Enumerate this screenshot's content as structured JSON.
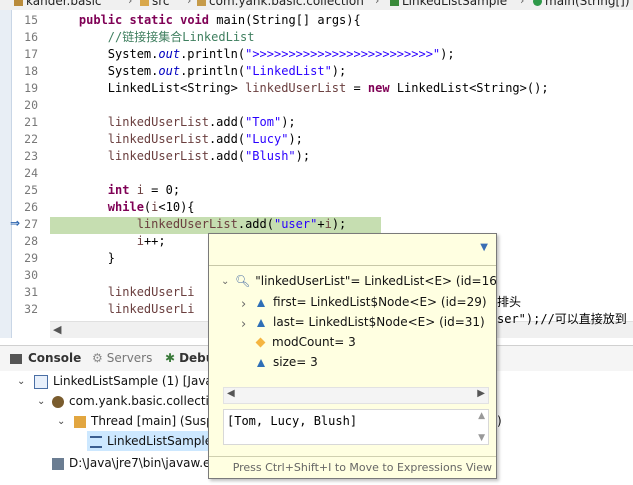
{
  "breadcrumb": {
    "items": [
      "kander.basic",
      "src",
      "com.yank.basic.collection",
      "LinkedListSample",
      "main(String[])"
    ]
  },
  "editor": {
    "lines": [
      {
        "num": "15",
        "code": "    public static void main(String[] args){"
      },
      {
        "num": "16",
        "code": "        //链接接集合LinkedList"
      },
      {
        "num": "17",
        "code": "        System.out.println(\">>>>>>>>>>>>>>>>>>>>>>>>>\");"
      },
      {
        "num": "18",
        "code": "        System.out.println(\"LinkedList\");"
      },
      {
        "num": "19",
        "code": "        LinkedList<String> linkedUserList = new LinkedList<String>();"
      },
      {
        "num": "20",
        "code": ""
      },
      {
        "num": "21",
        "code": "        linkedUserList.add(\"Tom\");"
      },
      {
        "num": "22",
        "code": "        linkedUserList.add(\"Lucy\");"
      },
      {
        "num": "23",
        "code": "        linkedUserList.add(\"Blush\");"
      },
      {
        "num": "24",
        "code": ""
      },
      {
        "num": "25",
        "code": "        int i = 0;"
      },
      {
        "num": "26",
        "code": "        while(i<10){"
      },
      {
        "num": "27",
        "code": "            linkedUserList.add(\"user\"+i);"
      },
      {
        "num": "28",
        "code": "            i++;"
      },
      {
        "num": "29",
        "code": "        }"
      },
      {
        "num": "30",
        "code": ""
      },
      {
        "num": "31",
        "code": "        linkedUserLi"
      },
      {
        "num": "32",
        "code": "        linkedUserLi"
      }
    ],
    "line31_tail": "排头",
    "line32_tail": "ser\");//可以直接放到"
  },
  "panel": {
    "tabs": [
      "Console",
      "Servers",
      "Debu"
    ],
    "tree": [
      {
        "label": "LinkedListSample (1) [Java"
      },
      {
        "label": "com.yank.basic.collecti"
      },
      {
        "label": "Thread [main] (Susp"
      },
      {
        "label": "LinkedListSample"
      },
      {
        "label": "D:\\Java\\jre7\\bin\\javaw.e"
      }
    ],
    "tree_tail": ")"
  },
  "popup": {
    "root": "\"linkedUserList\"= LinkedList<E>  (id=16",
    "children": [
      {
        "label": "first= LinkedList$Node<E>  (id=29)",
        "expandable": true,
        "icon": "field-triangle-icon"
      },
      {
        "label": "last= LinkedList$Node<E>  (id=31)",
        "expandable": true,
        "icon": "field-triangle-icon"
      },
      {
        "label": "modCount= 3",
        "expandable": false,
        "icon": "field-diamond-icon"
      },
      {
        "label": "size= 3",
        "expandable": false,
        "icon": "field-triangle-icon"
      }
    ],
    "detail": "[Tom, Lucy, Blush]",
    "footer": "Press Ctrl+Shift+I to Move to Expressions View"
  }
}
